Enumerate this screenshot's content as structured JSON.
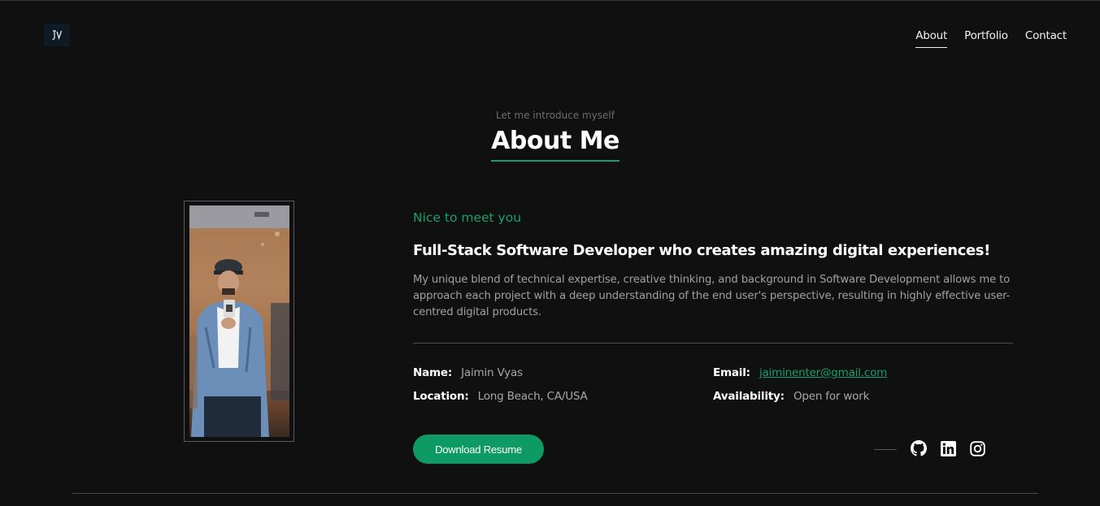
{
  "header": {
    "logo_icon": "jv-monogram-logo",
    "nav": [
      {
        "label": "About",
        "active": true
      },
      {
        "label": "Portfolio",
        "active": false
      },
      {
        "label": "Contact",
        "active": false
      }
    ]
  },
  "about": {
    "eyebrow": "Let me introduce myself",
    "title": "About Me",
    "greeting": "Nice to meet you",
    "headline": "Full-Stack Software Developer who creates amazing digital experiences!",
    "description": "My unique blend of technical expertise, creative thinking, and background in Software Development allows me to approach each project with a deep understanding of the end user's perspective, resulting in highly effective user-centred digital products.",
    "details": {
      "name_label": "Name:",
      "name_value": "Jaimin Vyas",
      "location_label": "Location:",
      "location_value": "Long Beach, CA/USA",
      "email_label": "Email:",
      "email_value": "jaiminenter@gmail.com",
      "availability_label": "Availability:",
      "availability_value": "Open for work"
    },
    "resume_button": "Download Resume",
    "socials": [
      "github-icon",
      "linkedin-icon",
      "instagram-icon"
    ]
  },
  "colors": {
    "background": "#101010",
    "accent": "#14a06b",
    "button": "#0e9a64",
    "muted_text": "#a0a0a0"
  }
}
